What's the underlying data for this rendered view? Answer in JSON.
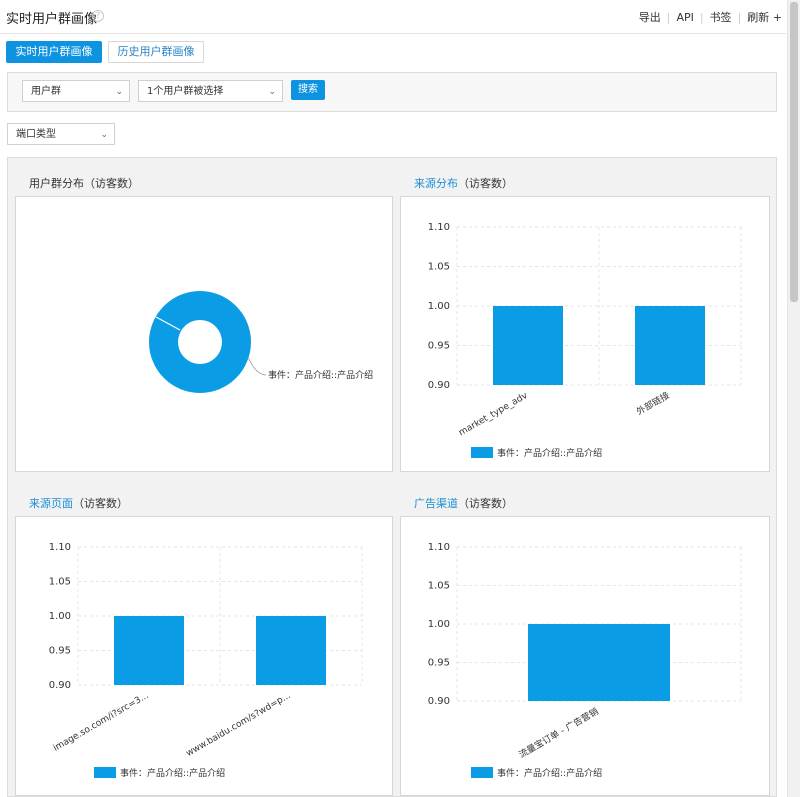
{
  "page": {
    "title": "实时用户群画像",
    "help_icon": "?"
  },
  "actions": {
    "export": "导出",
    "api": "API",
    "bookmark": "书签",
    "refresh": "刷新",
    "refresh_icon": "+"
  },
  "tabs": [
    {
      "label": "实时用户群画像"
    },
    {
      "label": "历史用户群画像"
    }
  ],
  "filters": {
    "group_select": "用户群",
    "selected_groups": "1个用户群被选择",
    "search_label": "搜索",
    "port_type": "端口类型"
  },
  "cards": {
    "distribution": {
      "title": "用户群分布（访客数）",
      "label": "事件：产品介绍::产品介绍"
    },
    "source": {
      "title_link": "来源分布",
      "title_rest": "（访客数）",
      "legend": "事件：产品介绍::产品介绍"
    },
    "page": {
      "title_link": "来源页面",
      "title_rest": "（访客数）",
      "legend": "事件：产品介绍::产品介绍"
    },
    "ad": {
      "title_link": "广告渠道",
      "title_rest": "（访客数）",
      "legend": "事件：产品介绍::产品介绍"
    }
  },
  "colors": {
    "accent": "#0e93e0",
    "series": "#0a9de6",
    "link": "#1a8fd6"
  },
  "chart_data": [
    {
      "type": "pie",
      "name": "用户群分布（访客数）",
      "categories": [
        "事件：产品介绍::产品介绍"
      ],
      "values": [
        1
      ],
      "donut": true
    },
    {
      "type": "bar",
      "title": "来源分布（访客数）",
      "categories": [
        "market_type_adv",
        "外部链接"
      ],
      "series": [
        {
          "name": "事件：产品介绍::产品介绍",
          "values": [
            1.0,
            1.0
          ]
        }
      ],
      "ylim": [
        0.9,
        1.1
      ],
      "yticks": [
        "0.90",
        "0.95",
        "1.00",
        "1.05",
        "1.10"
      ],
      "grid": true,
      "legend": "bottom"
    },
    {
      "type": "bar",
      "title": "来源页面（访客数）",
      "categories": [
        "image.so.com/i?src=3...",
        "www.baidu.com/s?wd=p..."
      ],
      "series": [
        {
          "name": "事件：产品介绍::产品介绍",
          "values": [
            1.0,
            1.0
          ]
        }
      ],
      "ylim": [
        0.9,
        1.1
      ],
      "yticks": [
        "0.90",
        "0.95",
        "1.00",
        "1.05",
        "1.10"
      ],
      "grid": true,
      "legend": "bottom"
    },
    {
      "type": "bar",
      "title": "广告渠道（访客数）",
      "categories": [
        "流量宝订单 - 广告营销"
      ],
      "series": [
        {
          "name": "事件：产品介绍::产品介绍",
          "values": [
            1.0
          ]
        }
      ],
      "ylim": [
        0.9,
        1.1
      ],
      "yticks": [
        "0.90",
        "0.95",
        "1.00",
        "1.05",
        "1.10"
      ],
      "grid": true,
      "legend": "bottom"
    }
  ]
}
